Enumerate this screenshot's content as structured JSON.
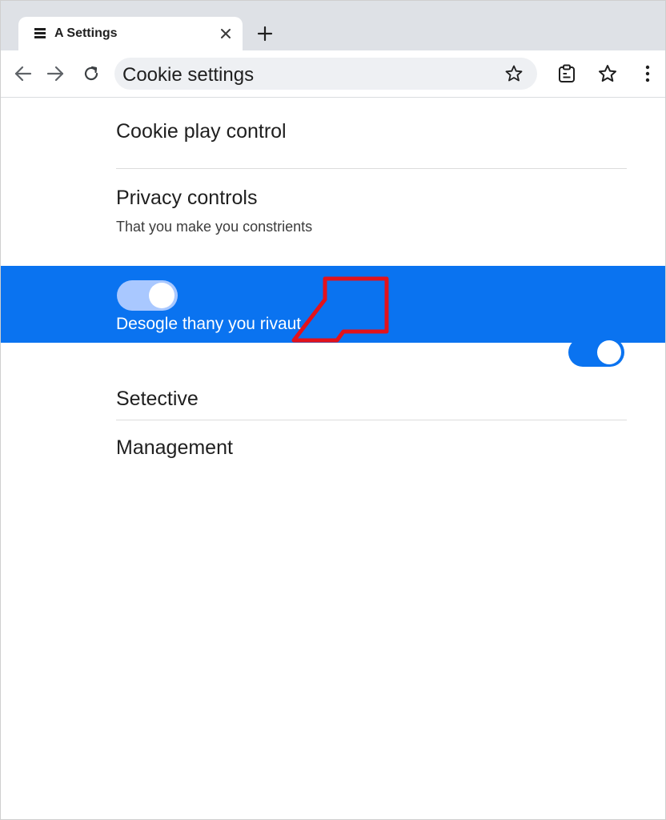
{
  "tab": {
    "title": "A Settings",
    "favicon": "settings-page-icon"
  },
  "toolbar": {
    "back_icon": "arrow-left-icon",
    "forward_icon": "arrow-right-icon",
    "reload_icon": "reload-icon",
    "omnibox_text": "Cookie settings",
    "bookmark_icon": "star-outline-icon",
    "extension_icon": "clipboard-icon",
    "menu_icon": "kebab-menu-icon"
  },
  "content": {
    "section1_title": "Cookie play control",
    "section2_title": "Privacy controls",
    "section2_subtitle": "That you make you constrients",
    "highlight_text": "Desogle thany you rivaut",
    "highlight_toggle_state": "on",
    "section3_title": "Setective",
    "management_label": "Management",
    "management_toggle_state": "on"
  },
  "colors": {
    "accent": "#0a73f0",
    "tabstrip": "#dee1e6",
    "annotation": "#e3121b"
  }
}
